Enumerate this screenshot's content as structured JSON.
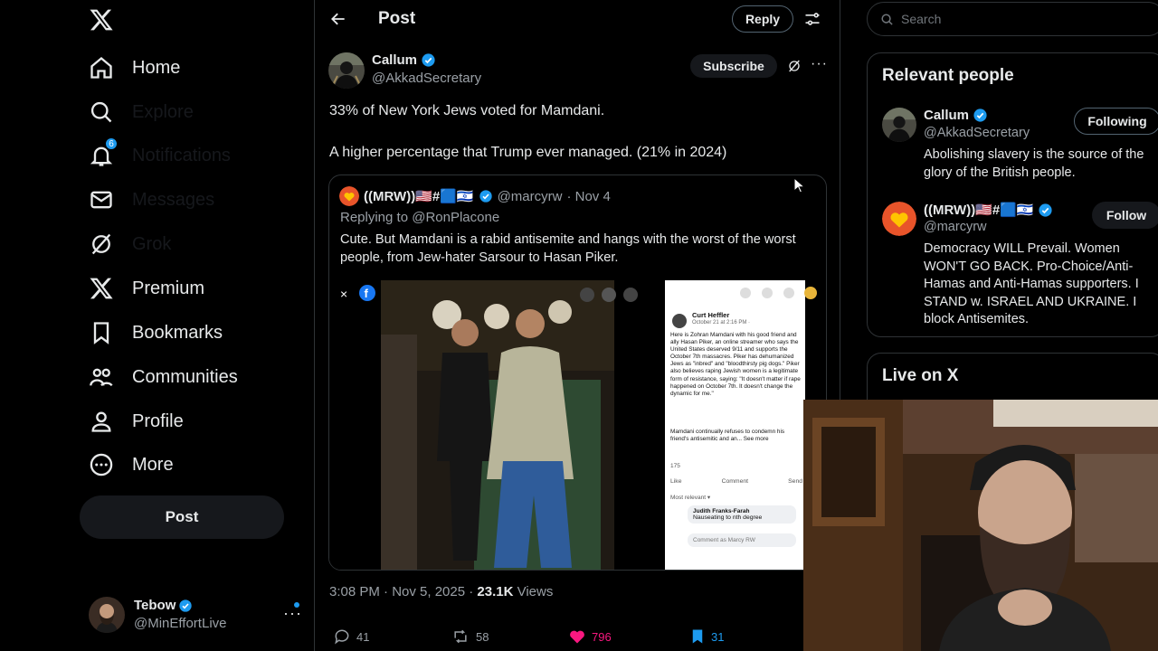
{
  "nav": {
    "logo": "x-logo-icon",
    "items": [
      {
        "label": "Home",
        "icon": "home-icon"
      },
      {
        "label": "Explore",
        "icon": "search-icon"
      },
      {
        "label": "Notifications",
        "icon": "bell-icon",
        "badge": "6"
      },
      {
        "label": "Messages",
        "icon": "envelope-icon"
      },
      {
        "label": "Grok",
        "icon": "grok-icon"
      },
      {
        "label": "Premium",
        "icon": "x-logo-icon"
      },
      {
        "label": "Bookmarks",
        "icon": "bookmark-icon"
      },
      {
        "label": "Communities",
        "icon": "people-icon"
      },
      {
        "label": "Profile",
        "icon": "person-icon"
      },
      {
        "label": "More",
        "icon": "more-circle-icon"
      }
    ],
    "post_label": "Post",
    "account": {
      "name": "Tebow",
      "handle": "@MinEffortLive"
    }
  },
  "header": {
    "title": "Post",
    "reply_label": "Reply"
  },
  "post": {
    "author_name": "Callum",
    "author_handle": "@AkkadSecretary",
    "subscribe_label": "Subscribe",
    "text_line1": "33% of New York Jews voted for Mamdani.",
    "text_line2": "A higher percentage that Trump ever managed. (21% in 2024)",
    "quote": {
      "name": "((MRW))🇺🇸#🟦🇮🇱",
      "handle": "@marcyrw",
      "date": "· Nov 4",
      "replying_to": "Replying to @RonPlacone",
      "text": "Cute. But Mamdani is a rabid antisemite and hangs with the worst of the worst people, from Jew-hater Sarsour to Hasan Piker.",
      "embed": {
        "fb_author": "Curt Heffler",
        "fb_date": "October 21 at 2:16 PM · ",
        "fb_text": "Here is Zohran Mamdani with his good friend and ally Hasan Piker, an online streamer who says the United States deserved 9/11 and supports the October 7th massacres. Piker has dehumanized Jews as \"inbred\" and \"bloodthirsty pig dogs.\" Piker also believes raping Jewish women is a legitimate form of resistance, saying: \"It doesn't matter if rape happened on October 7th. It doesn't change the dynamic for me.\"",
        "fb_text2": "Mamdani continually refuses to condemn his friend's antisemitic and an... See more",
        "fb_reactions": "175",
        "fb_like": "Like",
        "fb_comment": "Comment",
        "fb_send": "Send",
        "fb_most_relevant": "Most relevant ▾",
        "fb_commenter": "Judith Franks-Farah",
        "fb_comment_text": "Nauseating to nth degree",
        "fb_comment_as": "Comment as Marcy RW"
      }
    },
    "time": "3:08 PM · Nov 5, 2025 · ",
    "views_count": "23.1K",
    "views_label": " Views",
    "replies": "41",
    "reposts": "58",
    "likes": "796",
    "bookmarks": "31",
    "colors": {
      "like": "#f91880",
      "bookmark": "#1d9bf0",
      "verified": "#1d9bf0"
    }
  },
  "right": {
    "search_placeholder": "Search",
    "relevant_title": "Relevant people",
    "people": [
      {
        "name": "Callum",
        "handle": "@AkkadSecretary",
        "button": "Following",
        "bio": "Abolishing slavery is the source of the glory of the British people."
      },
      {
        "name": "((MRW))🇺🇸#🟦🇮🇱",
        "handle": "@marcyrw",
        "button": "Follow",
        "bio": "Democracy WILL Prevail. Women WON'T GO BACK. Pro-Choice/Anti-Hamas and Anti-Hamas supporters. I STAND w. ISRAEL AND UKRAINE. I block Antisemites."
      }
    ],
    "live_title": "Live on X"
  }
}
